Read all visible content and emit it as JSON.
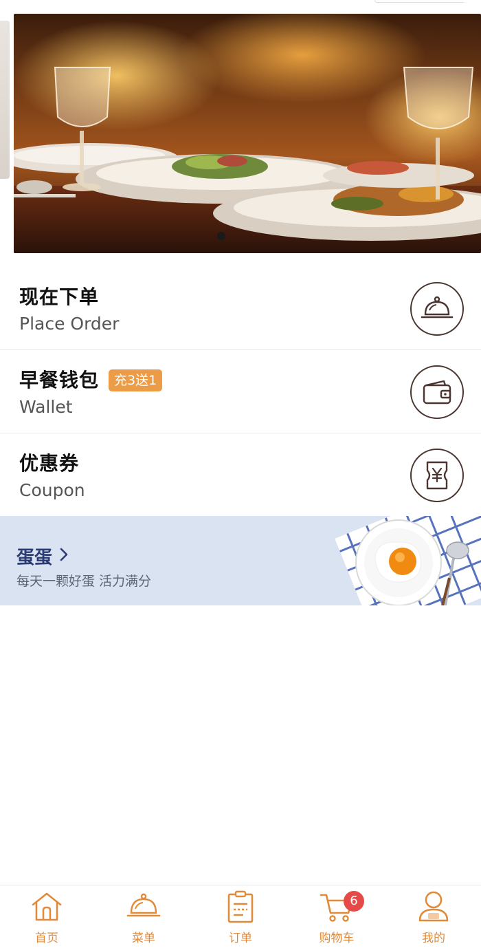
{
  "banner": {
    "image": "restaurant-dinner-table-photo",
    "pagination": {
      "current": 1,
      "total": 1
    }
  },
  "menu": [
    {
      "title": "现在下单",
      "subtitle": "Place Order",
      "icon": "cloche-icon"
    },
    {
      "title": "早餐钱包",
      "subtitle": "Wallet",
      "badge": "充3送1",
      "icon": "wallet-icon"
    },
    {
      "title": "优惠券",
      "subtitle": "Coupon",
      "icon": "coupon-icon"
    }
  ],
  "promo": {
    "title": "蛋蛋",
    "subtitle": "每天一颗好蛋 活力满分",
    "image": "fried-egg-plate"
  },
  "tabs": [
    {
      "label": "首页",
      "icon": "home-icon"
    },
    {
      "label": "菜单",
      "icon": "cloche-icon"
    },
    {
      "label": "订单",
      "icon": "order-list-icon"
    },
    {
      "label": "购物车",
      "icon": "cart-icon",
      "badge": "6"
    },
    {
      "label": "我的",
      "icon": "user-icon"
    }
  ],
  "colors": {
    "accent": "#e08a3a",
    "badge": "#e44a47",
    "promo_bg": "#dae3f2",
    "promo_title": "#2b3b75",
    "icon_stroke": "#4a3530",
    "tag_bg": "#ec9c47"
  }
}
